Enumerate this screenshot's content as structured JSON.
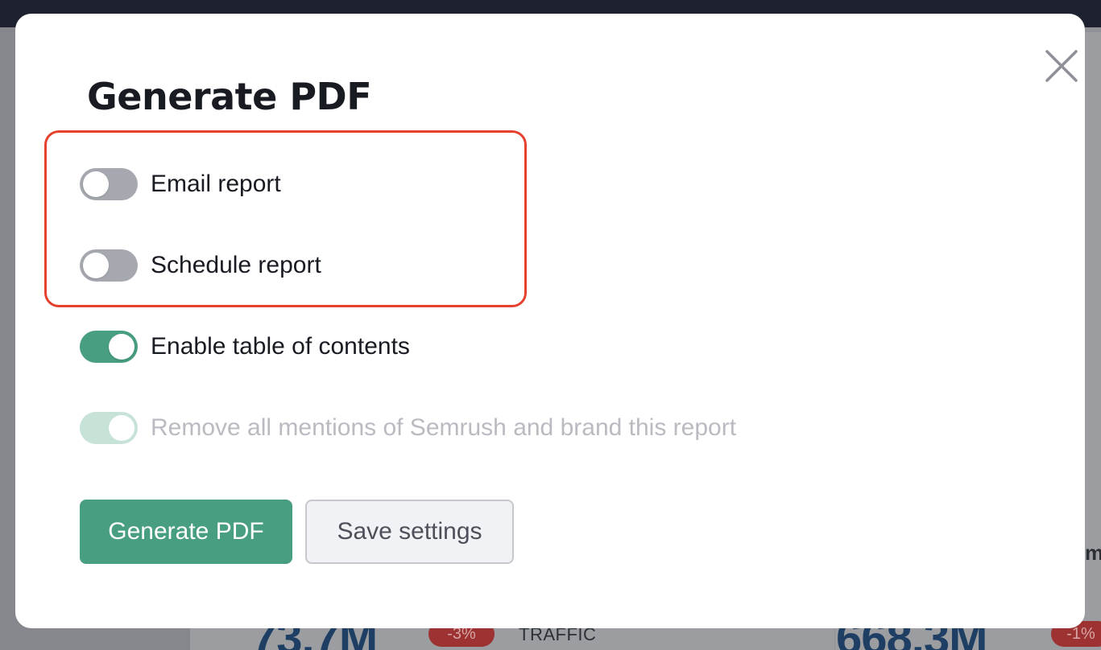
{
  "background": {
    "stats": [
      {
        "value": "73.7M",
        "change": "-3%",
        "label": "TRAFFIC"
      },
      {
        "value": "668.3M",
        "change": "-1%"
      }
    ],
    "edge_text": "m"
  },
  "modal": {
    "title": "Generate PDF",
    "close_icon": "close-icon",
    "options": [
      {
        "label": "Email report",
        "enabled": false,
        "disabled": false
      },
      {
        "label": "Schedule report",
        "enabled": false,
        "disabled": false
      },
      {
        "label": "Enable table of contents",
        "enabled": true,
        "disabled": false
      },
      {
        "label": "Remove all mentions of Semrush and brand this report",
        "enabled": true,
        "disabled": true
      }
    ],
    "buttons": {
      "primary_label": "Generate PDF",
      "secondary_label": "Save settings"
    }
  },
  "colors": {
    "accent": "#479e80",
    "highlight": "#e6412f",
    "switch_off": "#a6a8b0",
    "switch_disabled": "#c7e3d7",
    "title": "#191b23"
  }
}
